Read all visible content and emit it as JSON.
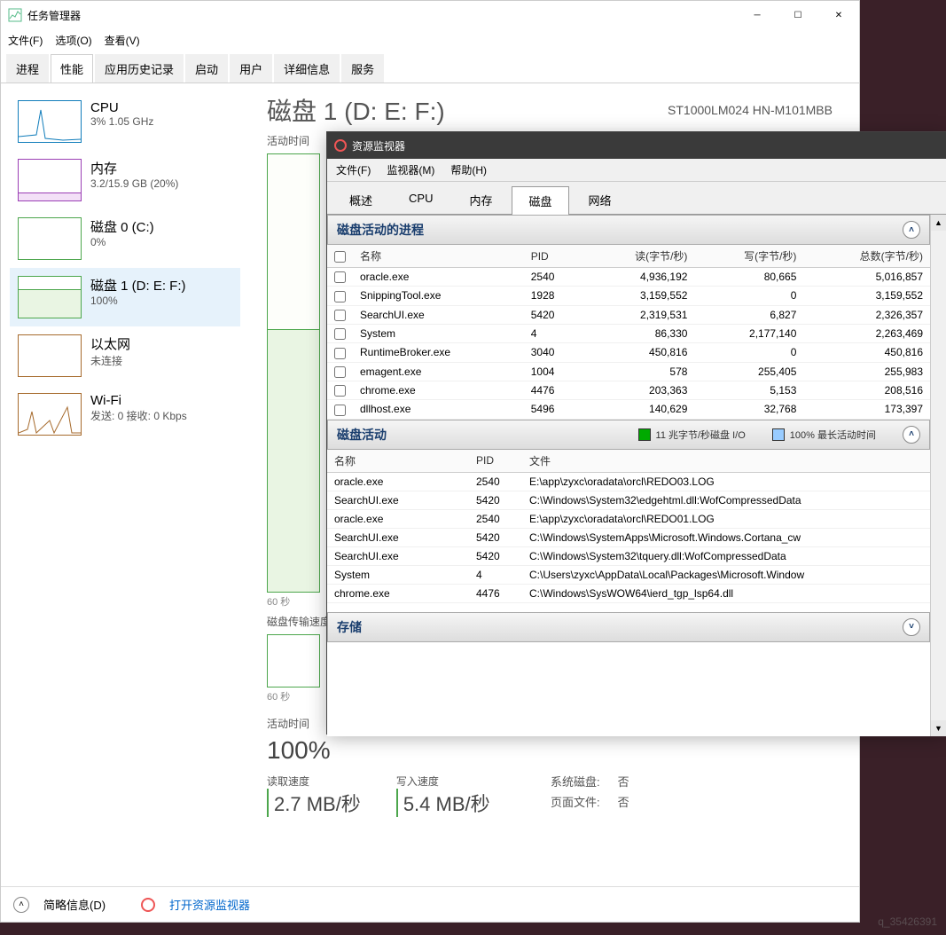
{
  "task_manager": {
    "title": "任务管理器",
    "menu": {
      "file": "文件(F)",
      "options": "选项(O)",
      "view": "查看(V)"
    },
    "tabs": [
      "进程",
      "性能",
      "应用历史记录",
      "启动",
      "用户",
      "详细信息",
      "服务"
    ],
    "active_tab": 1,
    "sidebar": [
      {
        "name": "CPU",
        "sub": "3%  1.05 GHz"
      },
      {
        "name": "内存",
        "sub": "3.2/15.9 GB (20%)"
      },
      {
        "name": "磁盘 0 (C:)",
        "sub": "0%"
      },
      {
        "name": "磁盘 1 (D: E: F:)",
        "sub": "100%"
      },
      {
        "name": "以太网",
        "sub": "未连接"
      },
      {
        "name": "Wi-Fi",
        "sub": "发送: 0  接收: 0 Kbps"
      }
    ],
    "selected_sidebar": 3,
    "main": {
      "title": "磁盘 1 (D: E: F:)",
      "model": "ST1000LM024 HN-M101MBB",
      "graph_label": "活动时间",
      "axis_sec": "60 秒",
      "transfer_label": "磁盘传输速度",
      "active_time_label": "活动时间",
      "active_time_value": "100%",
      "read_label": "读取速度",
      "read_value": "2.7 MB/秒",
      "write_label": "写入速度",
      "write_value": "5.4 MB/秒",
      "system_disk_label": "系统磁盘:",
      "system_disk_value": "否",
      "page_file_label": "页面文件:",
      "page_file_value": "否"
    },
    "footer": {
      "simple_view": "简略信息(D)",
      "open_resmon": "打开资源监视器"
    }
  },
  "resource_monitor": {
    "title": "资源监视器",
    "menu": {
      "file": "文件(F)",
      "monitor": "监视器(M)",
      "help": "帮助(H)"
    },
    "tabs": [
      "概述",
      "CPU",
      "内存",
      "磁盘",
      "网络"
    ],
    "active_tab": 3,
    "section1_title": "磁盘活动的进程",
    "table1_headers": {
      "name": "名称",
      "pid": "PID",
      "read": "读(字节/秒)",
      "write": "写(字节/秒)",
      "total": "总数(字节/秒)"
    },
    "table1_rows": [
      {
        "name": "oracle.exe",
        "pid": "2540",
        "read": "4,936,192",
        "write": "80,665",
        "total": "5,016,857"
      },
      {
        "name": "SnippingTool.exe",
        "pid": "1928",
        "read": "3,159,552",
        "write": "0",
        "total": "3,159,552"
      },
      {
        "name": "SearchUI.exe",
        "pid": "5420",
        "read": "2,319,531",
        "write": "6,827",
        "total": "2,326,357"
      },
      {
        "name": "System",
        "pid": "4",
        "read": "86,330",
        "write": "2,177,140",
        "total": "2,263,469"
      },
      {
        "name": "RuntimeBroker.exe",
        "pid": "3040",
        "read": "450,816",
        "write": "0",
        "total": "450,816"
      },
      {
        "name": "emagent.exe",
        "pid": "1004",
        "read": "578",
        "write": "255,405",
        "total": "255,983"
      },
      {
        "name": "chrome.exe",
        "pid": "4476",
        "read": "203,363",
        "write": "5,153",
        "total": "208,516"
      },
      {
        "name": "dllhost.exe",
        "pid": "5496",
        "read": "140,629",
        "write": "32,768",
        "total": "173,397"
      }
    ],
    "section2_title": "磁盘活动",
    "meter1": "11 兆字节/秒磁盘 I/O",
    "meter2": "100% 最长活动时间",
    "table2_headers": {
      "name": "名称",
      "pid": "PID",
      "file": "文件"
    },
    "table2_rows": [
      {
        "name": "oracle.exe",
        "pid": "2540",
        "file": "E:\\app\\zyxc\\oradata\\orcl\\REDO03.LOG"
      },
      {
        "name": "SearchUI.exe",
        "pid": "5420",
        "file": "C:\\Windows\\System32\\edgehtml.dll:WofCompressedData"
      },
      {
        "name": "oracle.exe",
        "pid": "2540",
        "file": "E:\\app\\zyxc\\oradata\\orcl\\REDO01.LOG"
      },
      {
        "name": "SearchUI.exe",
        "pid": "5420",
        "file": "C:\\Windows\\SystemApps\\Microsoft.Windows.Cortana_cw"
      },
      {
        "name": "SearchUI.exe",
        "pid": "5420",
        "file": "C:\\Windows\\System32\\tquery.dll:WofCompressedData"
      },
      {
        "name": "System",
        "pid": "4",
        "file": "C:\\Users\\zyxc\\AppData\\Local\\Packages\\Microsoft.Window"
      },
      {
        "name": "chrome.exe",
        "pid": "4476",
        "file": "C:\\Windows\\SysWOW64\\ierd_tgp_lsp64.dll"
      }
    ],
    "section3_title": "存储"
  },
  "watermark": "q_35426391"
}
